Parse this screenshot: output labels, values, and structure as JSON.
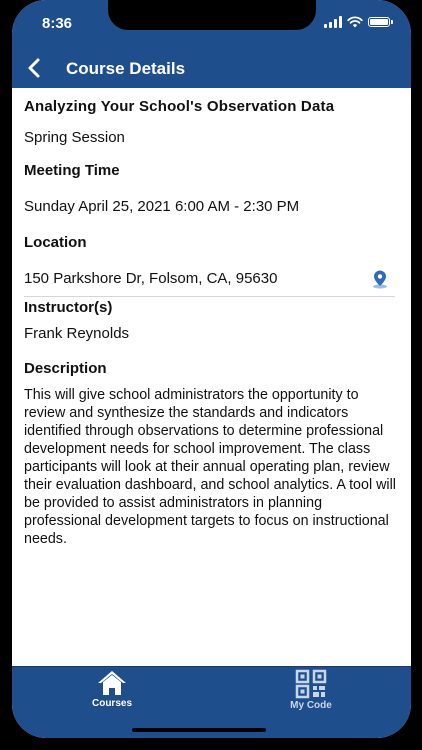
{
  "status_bar": {
    "time": "8:36"
  },
  "nav": {
    "title": "Course Details"
  },
  "course": {
    "title": "Analyzing Your School's Observation Data",
    "session": "Spring Session",
    "meeting_time_label": "Meeting Time",
    "meeting_time": "Sunday April 25, 2021 6:00 AM - 2:30 PM",
    "location_label": "Location",
    "location": "150 Parkshore Dr, Folsom, CA, 95630",
    "instructor_label": "Instructor(s)",
    "instructor": "Frank Reynolds",
    "description_label": "Description",
    "description": "This will give school administrators the opportunity to review and synthesize the standards and indicators identified through observations to determine professional development needs for school improvement. The class participants will look at their annual operating plan, review their evaluation dashboard, and school analytics. A tool will be provided to assist administrators in planning professional development targets to focus on instructional needs."
  },
  "tabs": [
    {
      "label": "Courses",
      "icon": "home-icon",
      "active": true
    },
    {
      "label": "My Code",
      "icon": "qr-code-icon",
      "active": false
    }
  ],
  "colors": {
    "primary": "#1f4e8c",
    "active_tab": "#ffffff",
    "inactive_tab": "#c9d6ea",
    "pin": "#2e6db5"
  }
}
